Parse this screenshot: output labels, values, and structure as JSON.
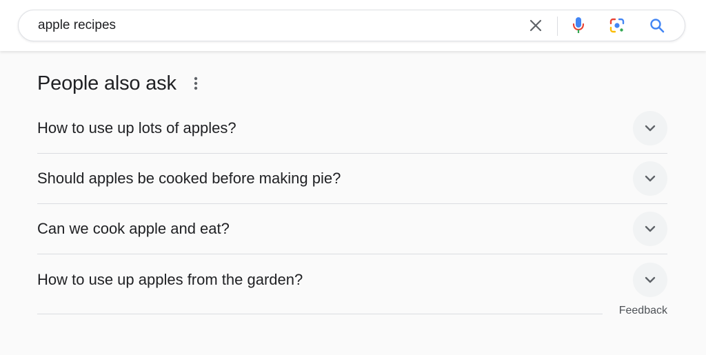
{
  "search": {
    "query": "apple recipes",
    "icons": {
      "clear": "close-icon",
      "voice": "microphone-icon",
      "image": "lens-icon",
      "submit": "search-icon"
    }
  },
  "paa": {
    "title": "People also ask",
    "questions": [
      "How to use up lots of apples?",
      "Should apples be cooked before making pie?",
      "Can we cook apple and eat?",
      "How to use up apples from the garden?"
    ],
    "feedback_label": "Feedback"
  },
  "colors": {
    "background": "#fafafa",
    "text": "#202124",
    "divider": "#dadce0",
    "chevron_bg": "#f1f3f4",
    "search_blue": "#4285f4",
    "mic_red": "#ea4335",
    "lens_yellow": "#fbbc04",
    "lens_green": "#34a853"
  }
}
